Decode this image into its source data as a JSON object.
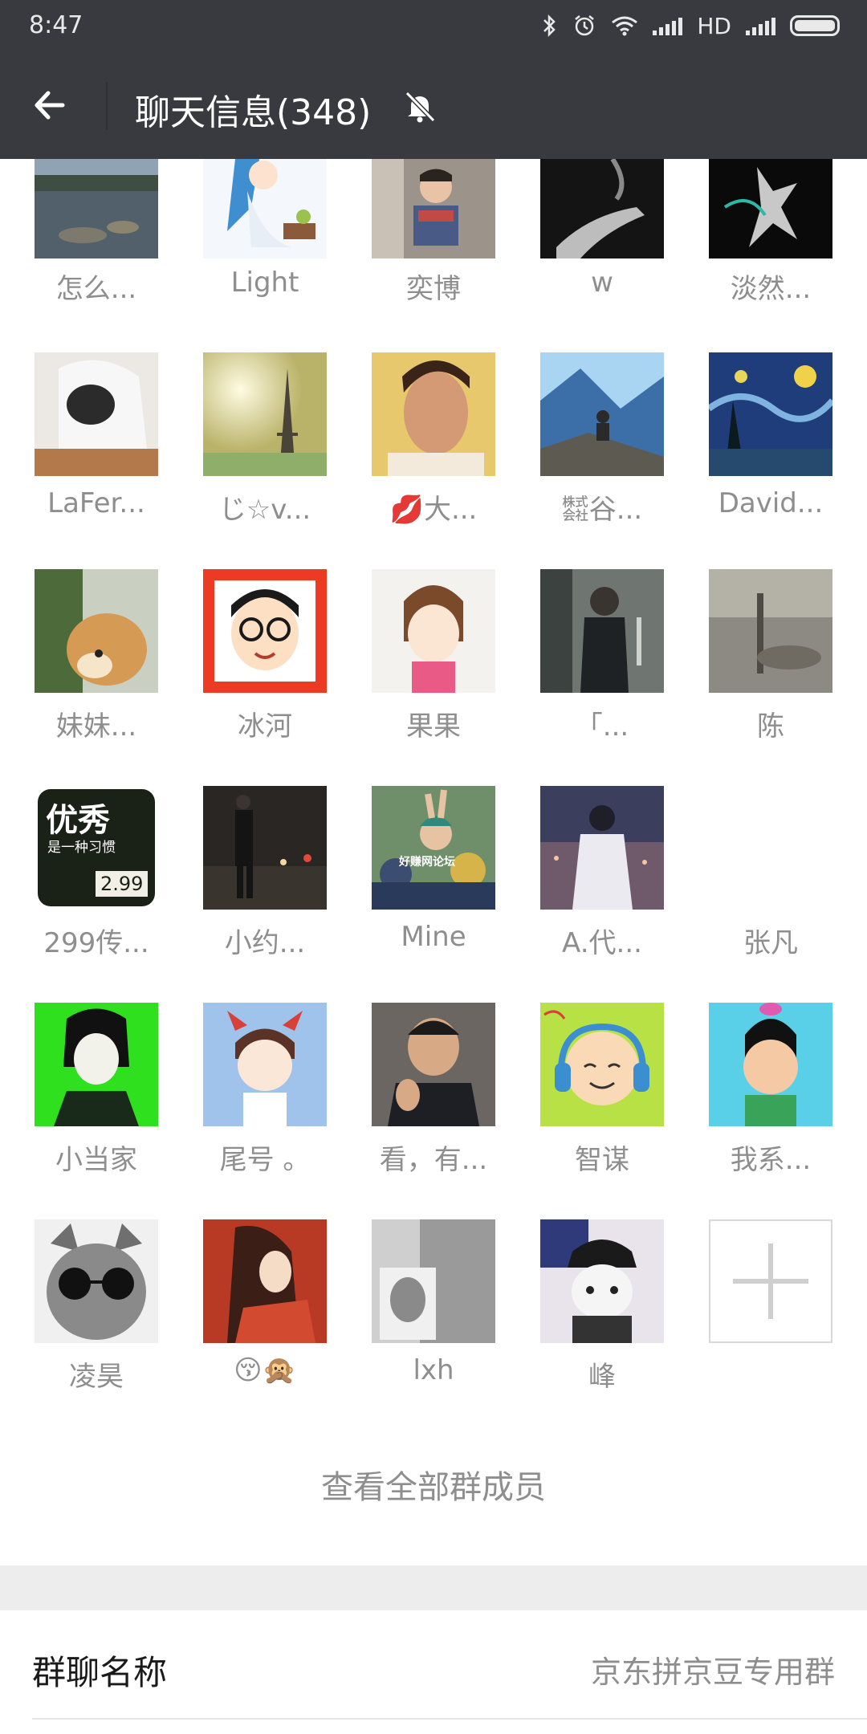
{
  "status_bar": {
    "time": "8:47",
    "hd": "HD"
  },
  "header": {
    "title": "聊天信息(348)"
  },
  "members": [
    {
      "name": "怎么...",
      "icon": "lake-landscape-avatar"
    },
    {
      "name": "Light",
      "icon": "cartoon-girl-avatar"
    },
    {
      "name": "奕博",
      "icon": "child-in-car-avatar"
    },
    {
      "name": "w",
      "icon": "smoking-hand-avatar"
    },
    {
      "name": "淡然...",
      "icon": "dancer-avatar"
    },
    {
      "name": "LaFer...",
      "icon": "hooded-person-avatar"
    },
    {
      "name": "じ☆v...",
      "icon": "eiffel-tower-avatar"
    },
    {
      "name": "💋大...",
      "icon": "man-portrait-avatar"
    },
    {
      "name": "㍿谷...",
      "icon": "mountain-person-avatar"
    },
    {
      "name": "David...",
      "icon": "starry-night-avatar"
    },
    {
      "name": "妹妹...",
      "icon": "shiba-dog-avatar"
    },
    {
      "name": "冰河",
      "icon": "cartoon-boy-glasses-avatar"
    },
    {
      "name": "果果",
      "icon": "anime-girl-avatar"
    },
    {
      "name": "「...",
      "icon": "man-in-dark-avatar"
    },
    {
      "name": "陈",
      "icon": "blurry-field-avatar"
    },
    {
      "name": "299传...",
      "icon": "youxiu-text-avatar"
    },
    {
      "name": "小约...",
      "icon": "night-street-avatar"
    },
    {
      "name": "Mine",
      "icon": "concert-crowd-avatar"
    },
    {
      "name": "A.代...",
      "icon": "lights-person-avatar"
    },
    {
      "name": "张凡",
      "icon": "blank-avatar"
    },
    {
      "name": "小当家",
      "icon": "green-cartoon-girl-avatar"
    },
    {
      "name": "尾号 。",
      "icon": "cartoon-devil-boy-avatar"
    },
    {
      "name": "看，有...",
      "icon": "clapping-man-avatar"
    },
    {
      "name": "智谋",
      "icon": "headphone-smile-avatar"
    },
    {
      "name": "我系...",
      "icon": "cartoon-gourd-kid-avatar"
    },
    {
      "name": "凌昊",
      "icon": "cat-sunglasses-avatar"
    },
    {
      "name": "😚🙊",
      "icon": "red-robe-avatar"
    },
    {
      "name": "lxh",
      "icon": "photo-portrait-avatar"
    },
    {
      "name": "峰",
      "icon": "cat-hat-avatar"
    }
  ],
  "avatar_text": {
    "youxiu_main": "优秀",
    "youxiu_sub": "是一种习惯",
    "youxiu_num": "2.99",
    "watermark": "好赚网论坛"
  },
  "view_all": "查看全部群成员",
  "group_name": {
    "label": "群聊名称",
    "value": "京东拼京豆专用群"
  },
  "colors": {
    "header_bg": "#393a3f",
    "text_gray": "#8e8e8e",
    "band": "#ededed"
  }
}
